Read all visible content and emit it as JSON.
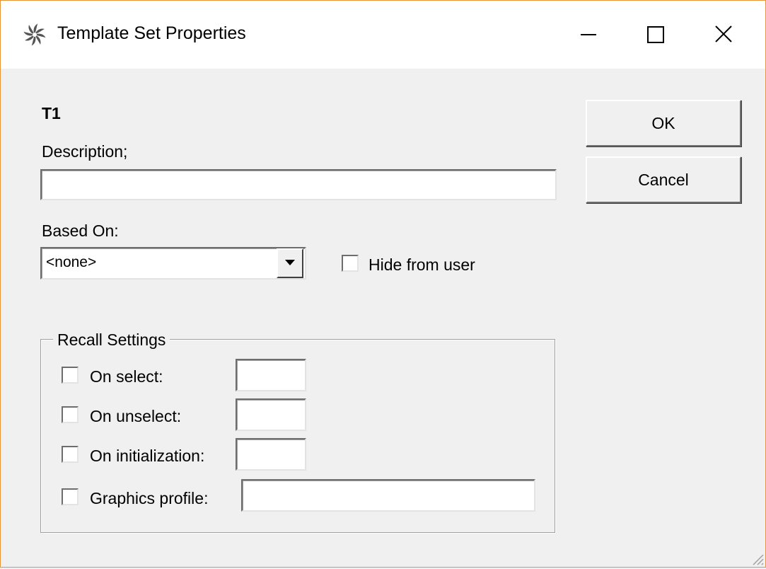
{
  "window": {
    "title": "Template Set Properties",
    "icon": "pinwheel-icon",
    "controls": [
      "minimize-icon",
      "maximize-icon",
      "close-icon"
    ]
  },
  "form": {
    "name": "T1",
    "description_label": "Description;",
    "description_value": "",
    "based_on_label": "Based On:",
    "based_on_value": "<none>",
    "hide_from_user_label": "Hide from user"
  },
  "buttons": {
    "ok": "OK",
    "cancel": "Cancel"
  },
  "recall": {
    "legend": "Recall Settings",
    "items": [
      {
        "label": "On select:",
        "value": ""
      },
      {
        "label": "On unselect:",
        "value": ""
      },
      {
        "label": "On initialization:",
        "value": ""
      },
      {
        "label": "Graphics profile:",
        "value": ""
      }
    ]
  },
  "colors": {
    "window_border": "#e8923a",
    "background": "#f0f0f0"
  }
}
